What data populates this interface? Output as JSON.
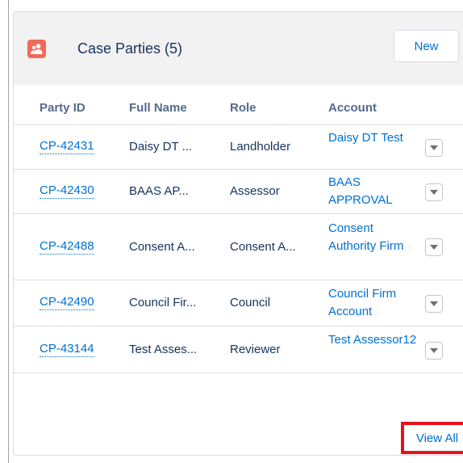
{
  "card": {
    "title": "Case Parties (5)",
    "icon": "people-icon",
    "new_button": "New",
    "view_all": "View All",
    "accent_color": "#f26a57",
    "highlight_color": "#e8111b"
  },
  "table": {
    "headers": [
      "Party ID",
      "Full Name",
      "Role",
      "Account"
    ],
    "rows": [
      {
        "party_id": "CP-42431",
        "full_name": "Daisy DT ...",
        "role": "Landholder",
        "account": "Daisy DT Test"
      },
      {
        "party_id": "CP-42430",
        "full_name": "BAAS AP...",
        "role": "Assessor",
        "account": "BAAS APPROVAL"
      },
      {
        "party_id": "CP-42488",
        "full_name": "Consent A...",
        "role": "Consent A...",
        "account": "Consent Authority Firm"
      },
      {
        "party_id": "CP-42490",
        "full_name": "Council Fir...",
        "role": "Council",
        "account": "Council Firm Account"
      },
      {
        "party_id": "CP-43144",
        "full_name": "Test Asses...",
        "role": "Reviewer",
        "account": "Test Assessor12"
      }
    ]
  }
}
